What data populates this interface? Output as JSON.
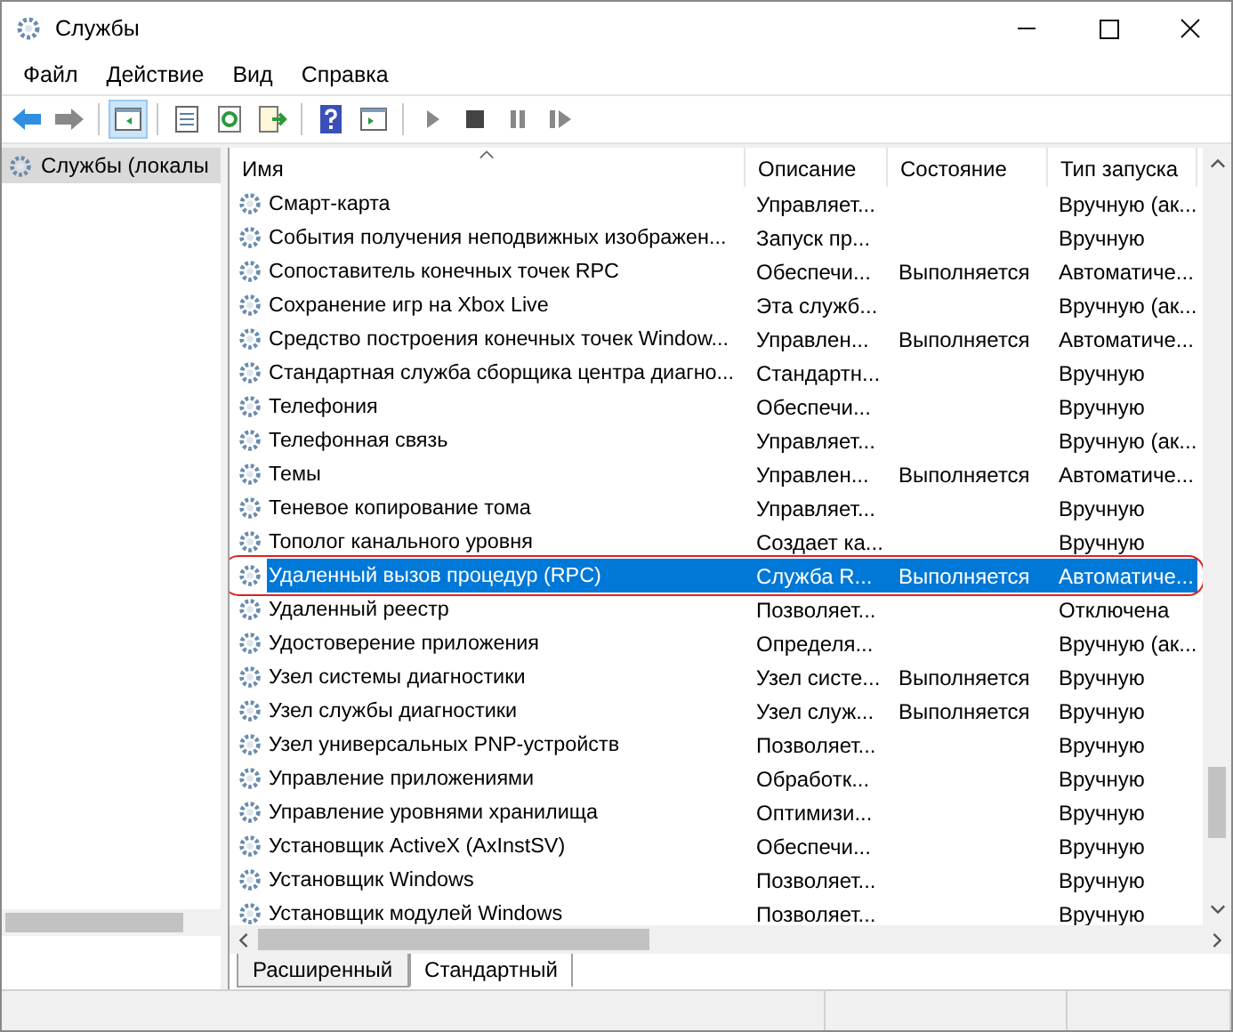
{
  "window": {
    "title": "Службы"
  },
  "menu": [
    "Файл",
    "Действие",
    "Вид",
    "Справка"
  ],
  "toolbar": [
    [
      {
        "kind": "back",
        "pressed": false
      },
      {
        "kind": "forward",
        "pressed": false
      }
    ],
    [
      {
        "kind": "tree",
        "pressed": true
      }
    ],
    [
      {
        "kind": "properties",
        "pressed": false
      },
      {
        "kind": "refresh",
        "pressed": false
      },
      {
        "kind": "export",
        "pressed": false
      }
    ],
    [
      {
        "kind": "help",
        "pressed": false
      },
      {
        "kind": "pane",
        "pressed": false
      }
    ],
    [
      {
        "kind": "play",
        "pressed": false
      },
      {
        "kind": "stop",
        "pressed": false
      },
      {
        "kind": "pause",
        "pressed": false
      },
      {
        "kind": "resume",
        "pressed": false
      }
    ]
  ],
  "sidebar": {
    "items": [
      {
        "label": "Службы (локалы",
        "selected": true
      }
    ]
  },
  "table": {
    "columns": [
      "Имя",
      "Описание",
      "Состояние",
      "Тип запуска"
    ],
    "rows": [
      {
        "name": "Смарт-карта",
        "description": "Управляет...",
        "status": "",
        "startup": "Вручную (ак...",
        "selected": false
      },
      {
        "name": "События получения неподвижных изображен...",
        "description": "Запуск пр...",
        "status": "",
        "startup": "Вручную",
        "selected": false
      },
      {
        "name": "Сопоставитель конечных точек RPC",
        "description": "Обеспечи...",
        "status": "Выполняется",
        "startup": "Автоматиче...",
        "selected": false
      },
      {
        "name": "Сохранение игр на Xbox Live",
        "description": "Эта служб...",
        "status": "",
        "startup": "Вручную (ак...",
        "selected": false
      },
      {
        "name": "Средство построения конечных точек Window...",
        "description": "Управлен...",
        "status": "Выполняется",
        "startup": "Автоматиче...",
        "selected": false
      },
      {
        "name": "Стандартная служба сборщика центра диагно...",
        "description": "Стандартн...",
        "status": "",
        "startup": "Вручную",
        "selected": false
      },
      {
        "name": "Телефония",
        "description": "Обеспечи...",
        "status": "",
        "startup": "Вручную",
        "selected": false
      },
      {
        "name": "Телефонная связь",
        "description": "Управляет...",
        "status": "",
        "startup": "Вручную (ак...",
        "selected": false
      },
      {
        "name": "Темы",
        "description": "Управлен...",
        "status": "Выполняется",
        "startup": "Автоматиче...",
        "selected": false
      },
      {
        "name": "Теневое копирование тома",
        "description": "Управляет...",
        "status": "",
        "startup": "Вручную",
        "selected": false
      },
      {
        "name": "Тополог канального уровня",
        "description": "Создает ка...",
        "status": "",
        "startup": "Вручную",
        "selected": false
      },
      {
        "name": "Удаленный вызов процедур (RPC)",
        "description": "Служба R...",
        "status": "Выполняется",
        "startup": "Автоматиче...",
        "selected": true,
        "highlighted": true
      },
      {
        "name": "Удаленный реестр",
        "description": "Позволяет...",
        "status": "",
        "startup": "Отключена",
        "selected": false
      },
      {
        "name": "Удостоверение приложения",
        "description": "Определя...",
        "status": "",
        "startup": "Вручную (ак...",
        "selected": false
      },
      {
        "name": "Узел системы диагностики",
        "description": "Узел систе...",
        "status": "Выполняется",
        "startup": "Вручную",
        "selected": false
      },
      {
        "name": "Узел службы диагностики",
        "description": "Узел служ...",
        "status": "Выполняется",
        "startup": "Вручную",
        "selected": false
      },
      {
        "name": "Узел универсальных PNP-устройств",
        "description": "Позволяет...",
        "status": "",
        "startup": "Вручную",
        "selected": false
      },
      {
        "name": "Управление приложениями",
        "description": "Обработк...",
        "status": "",
        "startup": "Вручную",
        "selected": false
      },
      {
        "name": "Управление уровнями хранилища",
        "description": "Оптимизи...",
        "status": "",
        "startup": "Вручную",
        "selected": false
      },
      {
        "name": "Установщик ActiveX (AxInstSV)",
        "description": "Обеспечи...",
        "status": "",
        "startup": "Вручную",
        "selected": false
      },
      {
        "name": "Установщик Windows",
        "description": "Позволяет...",
        "status": "",
        "startup": "Вручную",
        "selected": false
      },
      {
        "name": "Установщик модулей Windows",
        "description": "Позволяет...",
        "status": "",
        "startup": "Вручную",
        "selected": false
      }
    ]
  },
  "view_tabs": [
    {
      "label": "Расширенный",
      "selected": false
    },
    {
      "label": "Стандартный",
      "selected": true
    }
  ]
}
